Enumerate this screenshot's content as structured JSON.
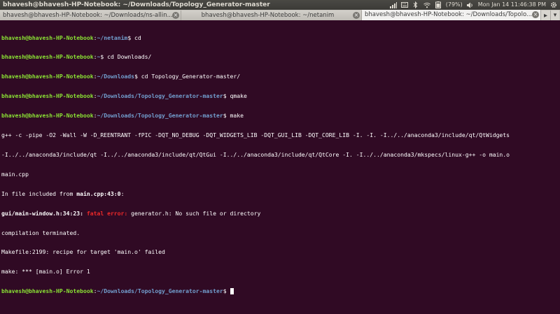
{
  "window": {
    "title": "bhavesh@bhavesh-HP-Notebook: ~/Downloads/Topology_Generator-master"
  },
  "tray": {
    "battery": "(79%)",
    "clock": "Mon Jan 14 11:46:38 PM"
  },
  "tabs": [
    {
      "label": "bhavesh@bhavesh-HP-Notebook: ~/Downloads/ns-allin...",
      "active": false
    },
    {
      "label": "bhavesh@bhavesh-HP-Notebook: ~/netanim",
      "active": false
    },
    {
      "label": "bhavesh@bhavesh-HP-Notebook: ~/Downloads/Topolo...",
      "active": true
    }
  ],
  "terminal": {
    "user": "bhavesh@bhavesh-HP-Notebook",
    "lines": [
      {
        "path": "~/netanim",
        "cmd": " cd"
      },
      {
        "path": "~",
        "cmd": " cd Downloads/"
      },
      {
        "path": "~/Downloads",
        "cmd": " cd Topology_Generator-master/"
      },
      {
        "path": "~/Downloads/Topology_Generator-master",
        "cmd": " qmake"
      },
      {
        "path": "~/Downloads/Topology_Generator-master",
        "cmd": " make"
      }
    ],
    "output1": "g++ -c -pipe -O2 -Wall -W -D_REENTRANT -fPIC -DQT_NO_DEBUG -DQT_WIDGETS_LIB -DQT_GUI_LIB -DQT_CORE_LIB -I. -I. -I../../anaconda3/include/qt/QtWidgets",
    "output2": "-I../../anaconda3/include/qt -I../../anaconda3/include/qt/QtGui -I../../anaconda3/include/qt/QtCore -I. -I../../anaconda3/mkspecs/linux-g++ -o main.o",
    "output3": "main.cpp",
    "included_prefix": "In file included from ",
    "included_file": "main.cpp:43:0",
    "included_suffix": ":",
    "error_location": "gui/main-window.h:34:23:",
    "error_label": "fatal error:",
    "error_message": " generator.h: No such file or directory",
    "output4": "compilation terminated.",
    "output5": "Makefile:2199: recipe for target 'main.o' failed",
    "output6": "make: *** [main.o] Error 1",
    "final_path": "~/Downloads/Topology_Generator-master"
  }
}
